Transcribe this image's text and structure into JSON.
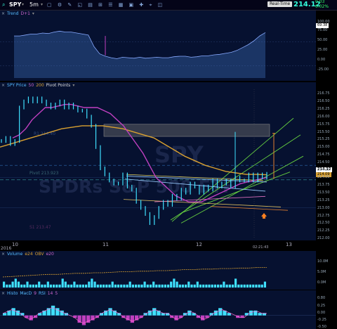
{
  "header": {
    "symbol": "SPY",
    "timeframe": "5m",
    "realtime": "Real-Time",
    "last": "214.12",
    "change": "0.03",
    "change_pct": "0.02%"
  },
  "trend": {
    "label": "Trend",
    "sub": "D+1",
    "ticks": [
      "100.00",
      "75.00",
      "50.00",
      "25.00",
      "0.00",
      "-25.00"
    ],
    "last": "69.38"
  },
  "price": {
    "label": "SPY Price",
    "ma1": "50",
    "ma2": "200",
    "pivot": "Pivot Points",
    "watermark1": "SPY",
    "watermark2": "SPDRs S&P 500 ETF",
    "pivot_label": "Pivot 213.923",
    "r1_label": "R1 214.40",
    "s1_label": "S1 213.47",
    "ticks": [
      "216.75",
      "216.50",
      "216.25",
      "216.00",
      "215.75",
      "215.50",
      "215.25",
      "215.00",
      "214.75",
      "214.50",
      "214.25",
      "214.00",
      "213.75",
      "213.50",
      "213.25",
      "213.00",
      "212.75",
      "212.50",
      "212.25",
      "212.00"
    ],
    "last_badge": "214.12",
    "last_badge2": "214.00",
    "ma200_badge": "214.09"
  },
  "xaxis": {
    "year": "2016",
    "labels": [
      "10",
      "11",
      "12",
      "13"
    ],
    "time": "02:21:43"
  },
  "volume": {
    "label": "Volume",
    "ma": "e24",
    "obv": "OBV",
    "obv_ma": "e20",
    "ticks": [
      "10.0M",
      "5.0M",
      "0.0M"
    ]
  },
  "oscillator": {
    "label": "Histo",
    "macd": "MacD",
    "p1": "9",
    "rsi": "RSI",
    "rsi_p": "14",
    "p3": "5",
    "ticks": [
      "0.80",
      "0.25",
      "0.00",
      "-0.25",
      "-0.50"
    ]
  },
  "colors": {
    "price": "#3fe0ff",
    "ma50": "#c040c0",
    "ma200": "#d9a030",
    "trend_line": "#44d044",
    "channel": "#88e050",
    "pivot": "#3a9a9a"
  },
  "chart_data": [
    {
      "type": "area",
      "title": "Trend",
      "series": [
        {
          "name": "D+1",
          "values": [
            62,
            62,
            64,
            66,
            66,
            68,
            67,
            70,
            72,
            70,
            70,
            68,
            66,
            64,
            40,
            25,
            20,
            17,
            15,
            18,
            17,
            16,
            18,
            16,
            17,
            18,
            17,
            17,
            19,
            20,
            20,
            18,
            19,
            21,
            21,
            23,
            24,
            26,
            28,
            32,
            38,
            44,
            52,
            62,
            69
          ]
        }
      ],
      "ylim": [
        -25,
        100
      ]
    },
    {
      "type": "line",
      "title": "SPY Price",
      "xlabels": [
        "10",
        "11",
        "12",
        "13"
      ],
      "ylim": [
        212,
        216.9
      ],
      "series": [
        {
          "name": "SPY Price",
          "values": [
            215.2,
            215.3,
            215.1,
            215.2,
            216.3,
            216.5,
            216.6,
            216.5,
            216.6,
            216.5,
            216.4,
            216.3,
            216.4,
            216.5,
            216.3,
            216.4,
            216.3,
            216.2,
            216.2,
            216.0,
            215.7,
            215.0,
            214.3,
            214.1,
            213.9,
            213.8,
            213.8,
            214.1,
            213.7,
            213.6,
            213.2,
            213.0,
            212.8,
            212.5,
            212.7,
            213.0,
            213.2,
            213.1,
            213.4,
            213.3,
            213.6,
            213.5,
            213.8,
            213.7,
            213.5,
            213.7,
            213.6,
            213.9,
            213.7,
            213.8,
            213.9,
            213.7,
            214.0,
            213.9,
            213.9,
            214.1,
            213.9,
            214.1,
            214.0,
            214.12
          ]
        },
        {
          "name": "MA 50",
          "values": [
            215.3,
            215.4,
            215.6,
            215.9,
            216.1,
            216.3,
            216.3,
            216.35,
            216.4,
            216.4,
            216.35,
            216.3,
            216.3,
            216.3,
            216.2,
            216.1,
            215.9,
            215.7,
            215.4,
            215.1,
            214.8,
            214.4,
            214.0,
            213.8,
            213.6,
            213.4,
            213.3,
            213.2,
            213.2,
            213.2,
            213.3,
            213.4,
            213.5,
            213.6,
            213.7,
            213.8,
            213.85,
            213.9,
            213.95,
            214.0
          ]
        },
        {
          "name": "MA 200",
          "values": [
            215.0,
            215.1,
            215.2,
            215.3,
            215.4,
            215.5,
            215.6,
            215.65,
            215.7,
            215.7,
            215.7,
            215.65,
            215.6,
            215.5,
            215.4,
            215.3,
            215.1,
            214.9,
            214.7,
            214.55,
            214.4,
            214.3,
            214.2,
            214.15,
            214.1,
            214.1,
            214.09
          ]
        }
      ]
    },
    {
      "type": "bar",
      "title": "Volume",
      "values": [
        2,
        1,
        1,
        2,
        3,
        2,
        1,
        1,
        2,
        1,
        1,
        1,
        2,
        1,
        1,
        2,
        1,
        1,
        1,
        1,
        3,
        2,
        1,
        1,
        2,
        1,
        1,
        1,
        1,
        2,
        3,
        2,
        1,
        1,
        1,
        1,
        1,
        2,
        1,
        1,
        1,
        1,
        1,
        2,
        1,
        1,
        1,
        1,
        2,
        1,
        1,
        2,
        1,
        1,
        1,
        1,
        1,
        2,
        3,
        2,
        1,
        1,
        1,
        2,
        1,
        1,
        2,
        1,
        1,
        1,
        1,
        1,
        1,
        1,
        1,
        2,
        1,
        1,
        1,
        3,
        1,
        1,
        1,
        1,
        1,
        1,
        1,
        1,
        1,
        2
      ],
      "ylim": [
        0,
        10
      ]
    },
    {
      "type": "bar",
      "title": "Histo",
      "values": [
        0.1,
        0.2,
        0.3,
        0.2,
        0.1,
        -0.1,
        -0.2,
        -0.1,
        0.1,
        0.2,
        0.3,
        0.4,
        0.3,
        0.2,
        0.1,
        0.0,
        -0.1,
        -0.3,
        -0.4,
        -0.3,
        -0.2,
        -0.1,
        0.1,
        0.2,
        0.3,
        0.2,
        0.1,
        -0.1,
        -0.2,
        -0.3,
        -0.2,
        -0.1,
        0.1,
        0.2,
        0.3,
        0.2,
        0.1,
        0.1,
        -0.1,
        -0.2,
        -0.1,
        0.1,
        0.2,
        0.1,
        -0.1,
        -0.2,
        -0.1,
        0.1,
        0.2,
        0.3,
        0.2,
        0.1,
        0.0,
        -0.1,
        -0.1,
        0.1,
        0.2,
        0.2,
        0.1,
        0.1
      ],
      "ylim": [
        -0.5,
        0.8
      ]
    }
  ]
}
